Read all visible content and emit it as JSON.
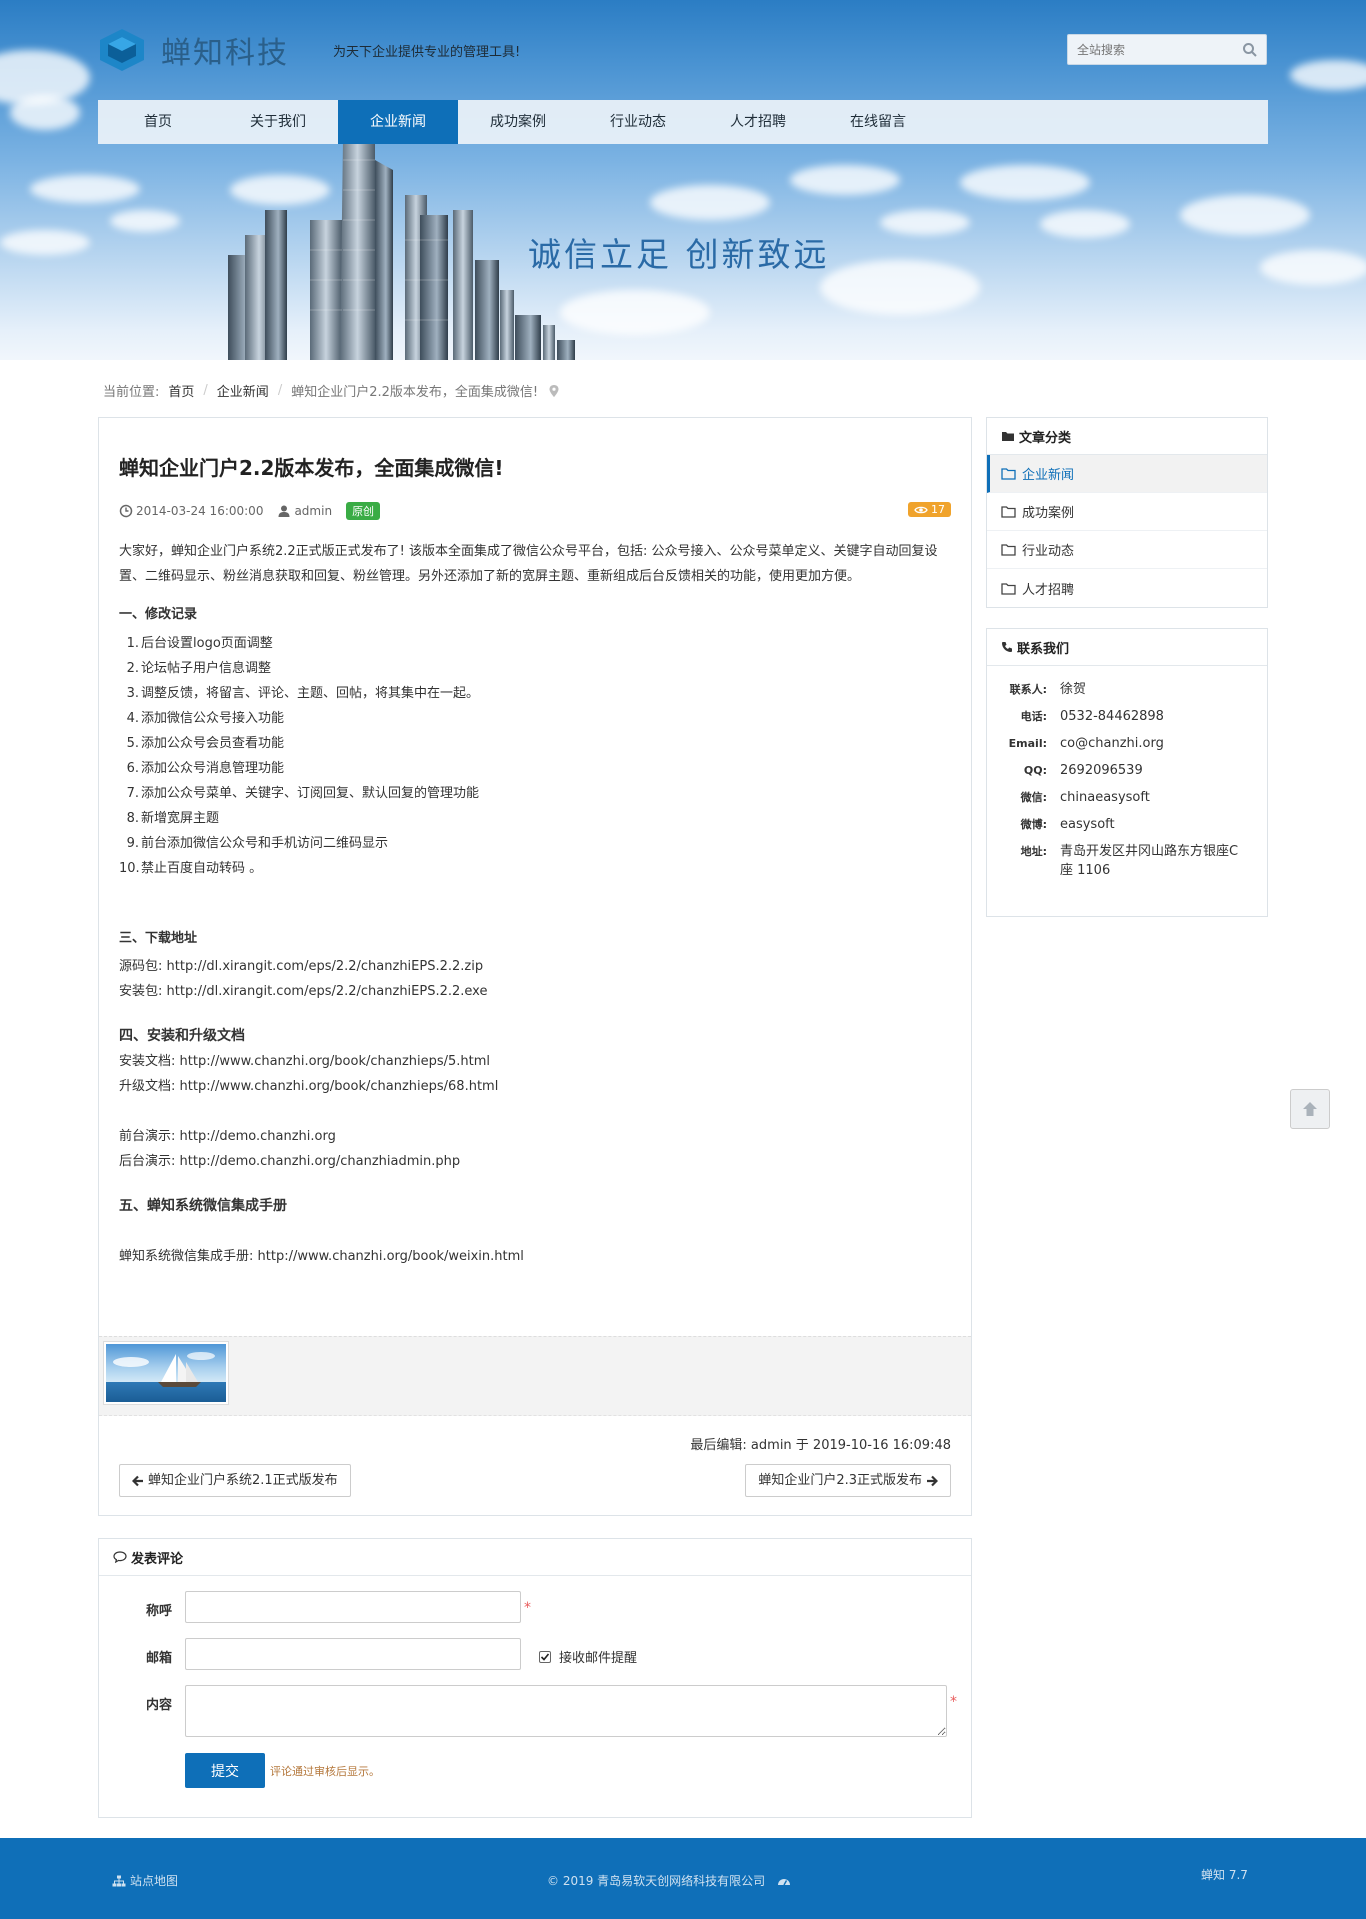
{
  "header": {
    "logo_text": "蝉知科技",
    "slogan": "为天下企业提供专业的管理工具!",
    "search_placeholder": "全站搜索",
    "banner_slogan": "诚信立足  创新致远",
    "colors": {
      "primary": "#0e6fb8",
      "nav_bg": "#e8f0f8",
      "logo_blue": "#2a5f8a"
    }
  },
  "nav": {
    "items": [
      {
        "label": "首页"
      },
      {
        "label": "关于我们"
      },
      {
        "label": "企业新闻"
      },
      {
        "label": "成功案例"
      },
      {
        "label": "行业动态"
      },
      {
        "label": "人才招聘"
      },
      {
        "label": "在线留言"
      }
    ],
    "active_index": 2
  },
  "breadcrumb": {
    "prefix": "当前位置:",
    "items": [
      "首页",
      "企业新闻"
    ],
    "current": "蝉知企业门户2.2版本发布，全面集成微信!"
  },
  "article": {
    "title": "蝉知企业门户2.2版本发布，全面集成微信!",
    "date": "2014-03-24 16:00:00",
    "author": "admin",
    "tag": "原创",
    "views": "17",
    "intro": "大家好，蝉知企业门户系统2.2正式版正式发布了! 该版本全面集成了微信公众号平台，包括: 公众号接入、公众号菜单定义、关键字自动回复设置、二维码显示、粉丝消息获取和回复、粉丝管理。另外还添加了新的宽屏主题、重新组成后台反馈相关的功能，使用更加方便。",
    "section1_title": "一、修改记录",
    "changes": [
      "后台设置logo页面调整",
      "论坛帖子用户信息调整",
      "调整反馈，将留言、评论、主题、回帖，将其集中在一起。",
      "添加微信公众号接入功能",
      "添加公众号会员查看功能",
      "添加公众号消息管理功能",
      "添加公众号菜单、关键字、订阅回复、默认回复的管理功能",
      "新增宽屏主题",
      "前台添加微信公众号和手机访问二维码显示",
      "禁止百度自动转码 。"
    ],
    "section3_title": "三、下载地址",
    "source_label": "源码包:",
    "source_url": "http://dl.xirangit.com/eps/2.2/chanzhiEPS.2.2.zip",
    "installer_label": "安装包:",
    "installer_url": "http://dl.xirangit.com/eps/2.2/chanzhiEPS.2.2.exe",
    "section4_title": "四、安装和升级文档",
    "install_doc_label": "安装文档:",
    "install_doc_url": "http://www.chanzhi.org/book/chanzhieps/5.html",
    "upgrade_doc_label": "升级文档:",
    "upgrade_doc_url": "http://www.chanzhi.org/book/chanzhieps/68.html",
    "demo_front_label": "前台演示:",
    "demo_front_url": "http://demo.chanzhi.org",
    "demo_back_label": "后台演示:",
    "demo_back_url": "http://demo.chanzhi.org/chanzhiadmin.php",
    "section5_title": "五、蝉知系统微信集成手册",
    "manual_label": "蝉知系统微信集成手册:",
    "manual_url": "http://www.chanzhi.org/book/weixin.html",
    "last_edit": "最后编辑: admin 于 2019-10-16 16:09:48",
    "prev": "蝉知企业门户系统2.1正式版发布",
    "next": "蝉知企业门户2.3正式版发布"
  },
  "comment": {
    "title": "发表评论",
    "name_label": "称呼",
    "email_label": "邮箱",
    "notify_label": "接收邮件提醒",
    "notify_checked": true,
    "content_label": "内容",
    "submit": "提交",
    "hint": "评论通过审核后显示。"
  },
  "sidebar": {
    "category_title": "文章分类",
    "categories": [
      "企业新闻",
      "成功案例",
      "行业动态",
      "人才招聘"
    ],
    "active_category": 0,
    "contact_title": "联系我们",
    "contacts": [
      {
        "label": "联系人:",
        "value": "徐贺"
      },
      {
        "label": "电话:",
        "value": "0532-84462898"
      },
      {
        "label": "Email:",
        "value": "co@chanzhi.org"
      },
      {
        "label": "QQ:",
        "value": "2692096539"
      },
      {
        "label": "微信:",
        "value": "chinaeasysoft"
      },
      {
        "label": "微博:",
        "value": "easysoft"
      },
      {
        "label": "地址:",
        "value": "青岛开发区井冈山路东方银座C座 1106"
      }
    ]
  },
  "footer": {
    "sitemap": "站点地图",
    "copyright": "© 2019 青岛易软天创网络科技有限公司",
    "version": "蝉知 7.7"
  }
}
